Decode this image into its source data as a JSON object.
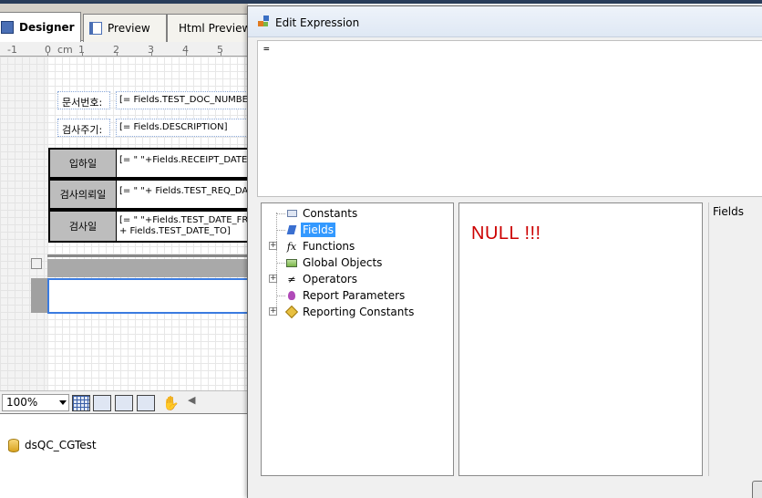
{
  "designer": {
    "tabs": [
      {
        "label": "Designer",
        "icon": "designer-icon"
      },
      {
        "label": "Preview",
        "icon": "preview-icon"
      },
      {
        "label": "Html Preview",
        "icon": "globe-icon"
      }
    ],
    "ruler_labels": [
      "-1",
      "0",
      "cm",
      "1",
      "2",
      "3",
      "4",
      "5"
    ],
    "report": {
      "doc_no_label": "문서번호:",
      "doc_no_field": "[= Fields.TEST_DOC_NUMBER",
      "cycle_label": "검사주기:",
      "cycle_field": "[= Fields.DESCRIPTION]",
      "rows": [
        {
          "header": "입하일",
          "field_line1": "[= \" \"+Fields.RECEIPT_DATE]",
          "field_line2": ""
        },
        {
          "header": "검사의뢰일",
          "field_line1": "[= \" \"+ Fields.TEST_REQ_DATE",
          "field_line2": ""
        },
        {
          "header": "검사일",
          "field_line1": "[= \" \"+Fields.TEST_DATE_FR",
          "field_line2": "+ Fields.TEST_DATE_TO]"
        }
      ]
    },
    "zoom": "100%",
    "datasource": "dsQC_CGTest"
  },
  "dialog": {
    "title": "Edit Expression",
    "expression": "=",
    "tree": [
      {
        "label": "Constants",
        "icon": "constants-icon",
        "expandable": false,
        "selected": false
      },
      {
        "label": "Fields",
        "icon": "fields-icon",
        "expandable": false,
        "selected": true
      },
      {
        "label": "Functions",
        "icon": "function-icon",
        "expandable": true,
        "selected": false
      },
      {
        "label": "Global Objects",
        "icon": "global-objects-icon",
        "expandable": false,
        "selected": false
      },
      {
        "label": "Operators",
        "icon": "operators-icon",
        "expandable": true,
        "selected": false
      },
      {
        "label": "Report Parameters",
        "icon": "parameter-icon",
        "expandable": false,
        "selected": false
      },
      {
        "label": "Reporting Constants",
        "icon": "reporting-constants-icon",
        "expandable": true,
        "selected": false
      }
    ],
    "list_message": "NULL !!!",
    "description_label": "Fields"
  },
  "colors": {
    "selection": "#3399ff",
    "null_text": "#cc0000",
    "header_cell": "#bdbdbd"
  }
}
